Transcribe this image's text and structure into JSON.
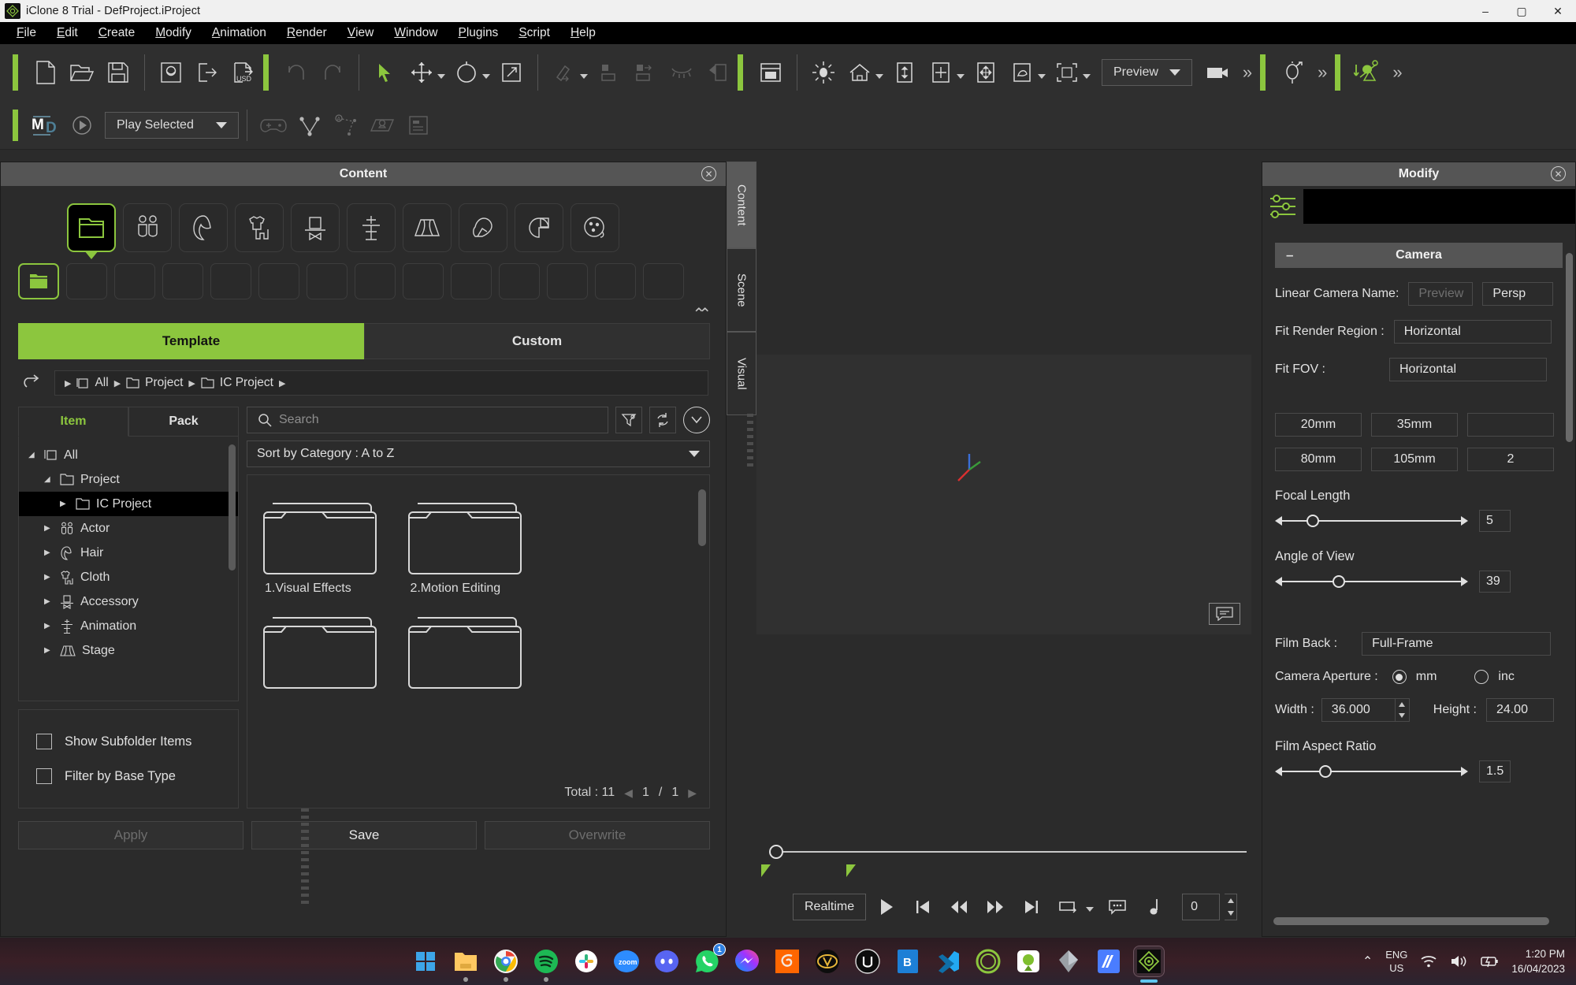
{
  "window": {
    "title": "iClone 8 Trial - DefProject.iProject",
    "app_icon": "iclone-logo-icon",
    "minimize": "–",
    "maximize": "▢",
    "close": "✕"
  },
  "menubar": {
    "items": [
      {
        "label": "File",
        "mnemonic": "F"
      },
      {
        "label": "Edit",
        "mnemonic": "E"
      },
      {
        "label": "Create",
        "mnemonic": "C"
      },
      {
        "label": "Modify",
        "mnemonic": "M"
      },
      {
        "label": "Animation",
        "mnemonic": "A"
      },
      {
        "label": "Render",
        "mnemonic": "R"
      },
      {
        "label": "View",
        "mnemonic": "V"
      },
      {
        "label": "Window",
        "mnemonic": "W"
      },
      {
        "label": "Plugins",
        "mnemonic": "P"
      },
      {
        "label": "Script",
        "mnemonic": "S"
      },
      {
        "label": "Help",
        "mnemonic": "H"
      }
    ]
  },
  "toolbar_main": {
    "groups": [
      {
        "icons": [
          "new-project-icon",
          "open-project-icon",
          "save-project-icon"
        ]
      },
      {
        "icons": [
          "import-icon",
          "export-icon",
          "export-usd-icon"
        ]
      },
      {
        "icons": [
          "undo-icon",
          "redo-icon"
        ]
      },
      {
        "icons": [
          "select-cursor-icon",
          "move-tool-icon",
          "rotate-tool-icon",
          "scale-tool-icon"
        ]
      },
      {
        "icons": [
          "link-icon",
          "align-icon",
          "align-right-icon",
          "hide-icon",
          "flip-icon"
        ]
      },
      {
        "icons": [
          "render-layout-icon",
          "light-icon",
          "home-icon",
          "align-vertical-icon",
          "align-grid-icon",
          "move-axis-icon",
          "transform-icon",
          "bounding-box-icon"
        ]
      }
    ],
    "preview_label": "Preview",
    "camera_icon": "camera-icon",
    "overflow_icon": "chevron-double-right-icon",
    "motion_icon": "motion-puppet-icon",
    "motion_director_icon": "motion-director-icon"
  },
  "toolbar_second": {
    "md_logo": "marvelous-designer-icon",
    "play_icon": "play-circle-icon",
    "dropdown_value": "Play Selected",
    "icons": [
      "gamepad-icon",
      "path-motion-icon",
      "path-constraint-icon",
      "terrain-icon",
      "prop-panel-icon"
    ]
  },
  "content_panel": {
    "title": "Content",
    "close_icon": "close-icon",
    "categories": [
      {
        "name": "folder-icon",
        "active": true
      },
      {
        "name": "actor-icon",
        "active": false
      },
      {
        "name": "hair-icon",
        "active": false
      },
      {
        "name": "cloth-icon",
        "active": false
      },
      {
        "name": "accessory-icon",
        "active": false
      },
      {
        "name": "animation-icon",
        "active": false
      },
      {
        "name": "stage-icon",
        "active": false
      },
      {
        "name": "prop-icon",
        "active": false
      },
      {
        "name": "media-icon",
        "active": false
      },
      {
        "name": "particle-icon",
        "active": false
      }
    ],
    "subcategory_count": 14,
    "collapse_icon": "chevron-double-up-icon",
    "tabs": [
      {
        "label": "Template",
        "selected": true
      },
      {
        "label": "Custom",
        "selected": false
      }
    ],
    "back_icon": "back-arrow-icon",
    "breadcrumb": [
      {
        "label": "All",
        "icon": "stack-icon"
      },
      {
        "label": "Project",
        "icon": "folder-icon"
      },
      {
        "label": "IC Project",
        "icon": "folder-icon"
      }
    ],
    "item_pack_tabs": [
      {
        "label": "Item",
        "selected": true
      },
      {
        "label": "Pack",
        "selected": false
      }
    ],
    "tree": [
      {
        "label": "All",
        "icon": "stack-icon",
        "depth": 0,
        "expanded": true,
        "selected": false
      },
      {
        "label": "Project",
        "icon": "folder-icon",
        "depth": 1,
        "expanded": true,
        "selected": false
      },
      {
        "label": "IC Project",
        "icon": "folder-icon",
        "depth": 2,
        "expanded": false,
        "selected": true
      },
      {
        "label": "Actor",
        "icon": "actor-icon",
        "depth": 1,
        "expanded": false,
        "selected": false
      },
      {
        "label": "Hair",
        "icon": "hair-icon",
        "depth": 1,
        "expanded": false,
        "selected": false
      },
      {
        "label": "Cloth",
        "icon": "cloth-icon",
        "depth": 1,
        "expanded": false,
        "selected": false
      },
      {
        "label": "Accessory",
        "icon": "accessory-icon",
        "depth": 1,
        "expanded": false,
        "selected": false
      },
      {
        "label": "Animation",
        "icon": "animation-icon",
        "depth": 1,
        "expanded": false,
        "selected": false
      },
      {
        "label": "Stage",
        "icon": "stage-icon",
        "depth": 1,
        "expanded": false,
        "selected": false
      }
    ],
    "options": [
      {
        "label": "Show Subfolder Items",
        "checked": false
      },
      {
        "label": "Filter by Base Type",
        "checked": false
      }
    ],
    "search": {
      "placeholder": "Search",
      "value": "",
      "icon": "search-icon"
    },
    "filter_icon": "filter-settings-icon",
    "refresh_icon": "refresh-icon",
    "expand_icon": "chevron-down-circle-icon",
    "sort": {
      "label": "Sort by Category : A to Z"
    },
    "items": [
      {
        "label": "1.Visual Effects",
        "icon": "folder-thumb-icon"
      },
      {
        "label": "2.Motion Editing",
        "icon": "folder-thumb-icon"
      },
      {
        "label": "",
        "icon": "folder-thumb-icon"
      },
      {
        "label": "",
        "icon": "folder-thumb-icon"
      }
    ],
    "pager": {
      "total_label": "Total : 11",
      "current": "1",
      "sep": "/",
      "pages": "1",
      "prev_icon": "triangle-left-icon",
      "next_icon": "triangle-right-icon"
    },
    "buttons": [
      {
        "label": "Apply",
        "enabled": false
      },
      {
        "label": "Save",
        "enabled": true
      },
      {
        "label": "Overwrite",
        "enabled": false
      }
    ]
  },
  "side_tabs": [
    {
      "label": "Content",
      "active": true
    },
    {
      "label": "Scene",
      "active": false
    },
    {
      "label": "Visual",
      "active": false
    }
  ],
  "viewport": {
    "note_icon": "comment-icon",
    "gizmo": {
      "x_axis": "#d83030",
      "y_axis": "#8cc63e",
      "z_axis": "#3a6fd8"
    },
    "timeline": {
      "playhead_position": 0,
      "marker_icon": "range-marker-icon"
    },
    "playback": {
      "mode_label": "Realtime",
      "buttons": [
        {
          "name": "play-button",
          "glyph": "▶"
        },
        {
          "name": "go-to-start-button",
          "glyph": "|◀"
        },
        {
          "name": "step-back-button",
          "glyph": "◀◀"
        },
        {
          "name": "step-forward-button",
          "glyph": "▶▶"
        },
        {
          "name": "go-to-end-button",
          "glyph": "▶|"
        },
        {
          "name": "loop-button",
          "glyph": "loop-icon"
        },
        {
          "name": "subtitle-button",
          "glyph": "subtitle-icon"
        },
        {
          "name": "audio-button",
          "glyph": "music-note-icon"
        }
      ],
      "frame_value": "0"
    }
  },
  "modify_panel": {
    "title": "Modify",
    "close_icon": "close-icon",
    "settings_icon": "sliders-icon",
    "section": {
      "title": "Camera",
      "collapse_glyph": "–"
    },
    "linear_camera_name": {
      "label": "Linear Camera Name:",
      "value": "Preview",
      "type_value": "Persp"
    },
    "fit_render_region": {
      "label": "Fit Render Region :",
      "value": "Horizontal"
    },
    "fit_fov": {
      "label": "Fit FOV :",
      "value": "Horizontal"
    },
    "lens_presets": [
      [
        "20mm",
        "35mm",
        ""
      ],
      [
        "80mm",
        "105mm",
        "2"
      ]
    ],
    "focal_length": {
      "label": "Focal Length",
      "value": "5",
      "knob_pct": 19
    },
    "angle_of_view": {
      "label": "Angle of View",
      "value": "39",
      "knob_pct": 33
    },
    "film_back": {
      "label": "Film Back :",
      "value": "Full-Frame"
    },
    "camera_aperture": {
      "label": "Camera Aperture :",
      "options": [
        {
          "label": "mm",
          "selected": true
        },
        {
          "label": "inc",
          "selected": false
        }
      ]
    },
    "width": {
      "label": "Width :",
      "value": "36.000"
    },
    "height": {
      "label": "Height :",
      "value": "24.00"
    },
    "film_aspect_ratio": {
      "label": "Film Aspect Ratio",
      "value": "1.5",
      "knob_pct": 24
    }
  },
  "taskbar": {
    "apps": [
      {
        "name": "start-button",
        "glyph": "windows-icon",
        "color": "#3da5e8",
        "running": false
      },
      {
        "name": "file-explorer",
        "glyph": "folder-icon",
        "color": "#ffc861",
        "running": true
      },
      {
        "name": "google-chrome",
        "glyph": "chrome-icon",
        "color": "#ffffff",
        "running": true
      },
      {
        "name": "spotify",
        "glyph": "spotify-icon",
        "color": "#1db954",
        "running": true
      },
      {
        "name": "slack",
        "glyph": "slack-icon",
        "color": "#ffffff",
        "running": false
      },
      {
        "name": "zoom",
        "glyph": "zoom-icon",
        "color": "#2d8cff",
        "running": false
      },
      {
        "name": "discord",
        "glyph": "discord-icon",
        "color": "#5865f2",
        "running": false
      },
      {
        "name": "whatsapp",
        "glyph": "whatsapp-icon",
        "color": "#25d366",
        "running": false,
        "badge": "1"
      },
      {
        "name": "messenger",
        "glyph": "messenger-icon",
        "color": "#a334fa",
        "running": false
      },
      {
        "name": "houdini",
        "glyph": "houdini-icon",
        "color": "#ff6600",
        "running": false
      },
      {
        "name": "maya",
        "glyph": "maya-icon",
        "color": "#0d0d0d",
        "running": false
      },
      {
        "name": "unreal-engine",
        "glyph": "unreal-icon",
        "color": "#0d0d0d",
        "running": false
      },
      {
        "name": "bluestacks",
        "glyph": "blue-app-icon",
        "color": "#1d7fd6",
        "running": false
      },
      {
        "name": "vs-code",
        "glyph": "vscode-icon",
        "color": "#23a9f2",
        "running": false
      },
      {
        "name": "character-creator",
        "glyph": "cc-ring-icon",
        "color": "#8cc63e",
        "running": false
      },
      {
        "name": "reallusion-hub",
        "glyph": "hub-icon",
        "color": "#8cc63e",
        "running": false
      },
      {
        "name": "blender",
        "glyph": "blender-icon",
        "color": "#9aa0a6",
        "running": false
      },
      {
        "name": "adobe-app",
        "glyph": "adobe-icon",
        "color": "#4a7dff",
        "running": false
      },
      {
        "name": "iclone-8",
        "glyph": "iclone-logo-icon",
        "color": "#8cc63e",
        "running": true,
        "active": true
      }
    ],
    "tray": {
      "chevron_icon": "chevron-up-icon",
      "language_top": "ENG",
      "language_bottom": "US",
      "wifi_icon": "wifi-icon",
      "volume_icon": "speaker-icon",
      "battery_icon": "battery-icon",
      "time": "1:20 PM",
      "date": "16/04/2023"
    }
  }
}
